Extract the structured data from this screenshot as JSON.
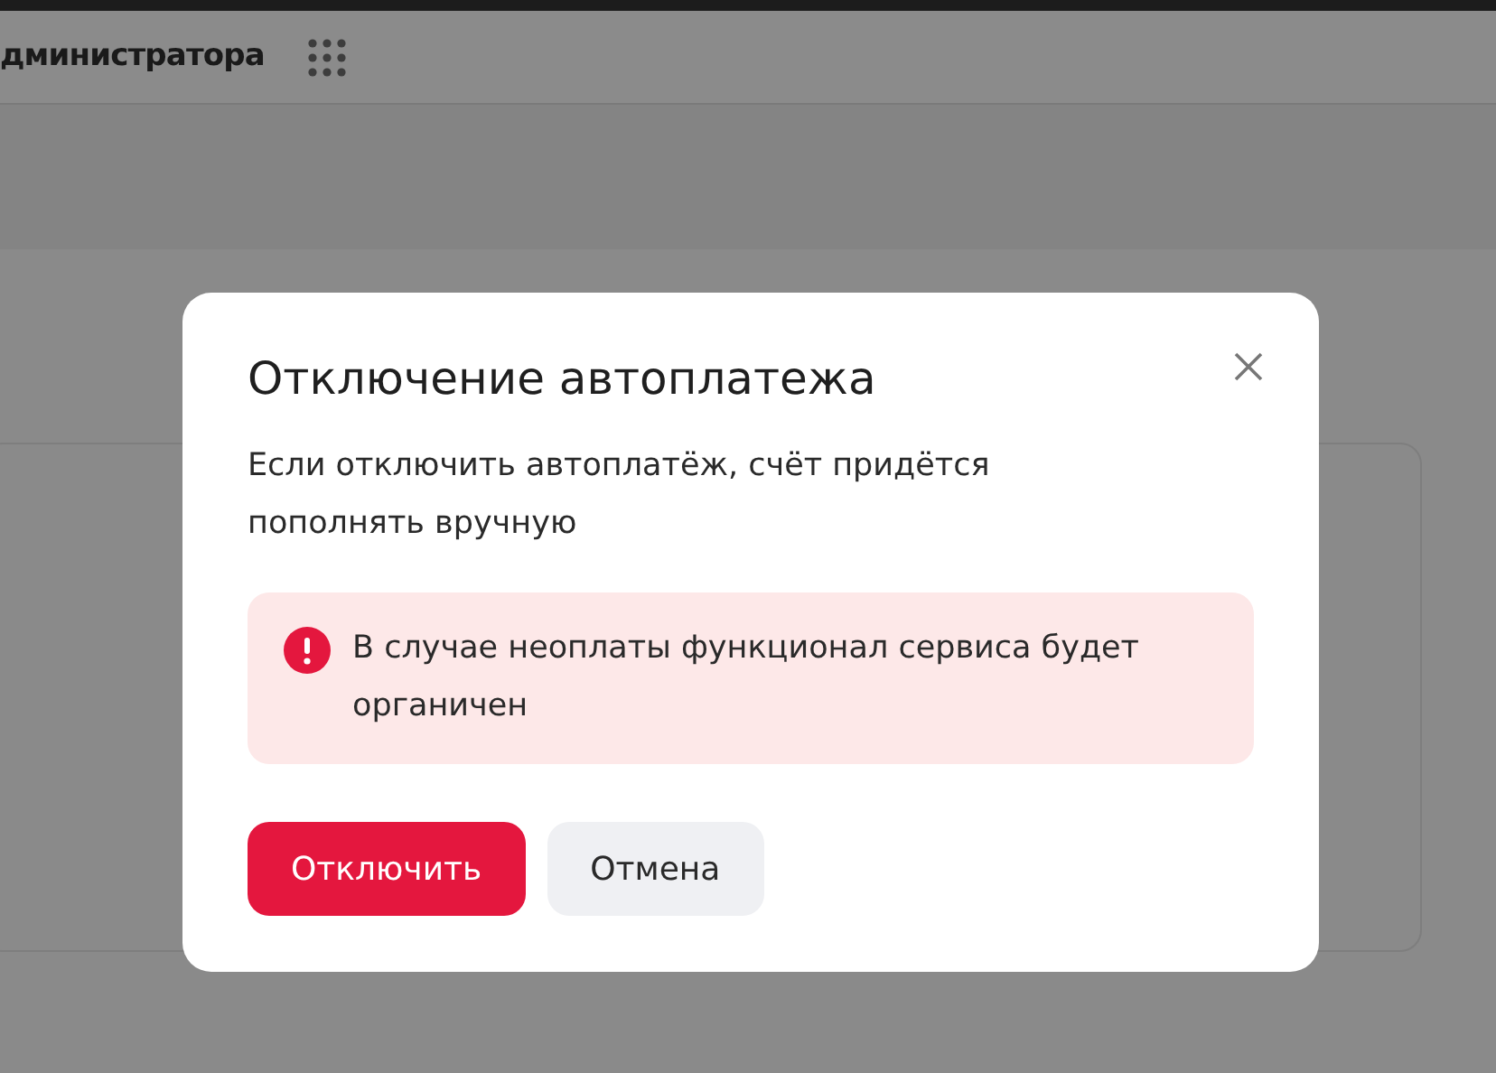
{
  "header": {
    "title": "дминистратора"
  },
  "dialog": {
    "title": "Отключение автоплатежа",
    "message": "Если отключить автоплатёж, счёт придётся пополнять вручную",
    "alert": {
      "text": "В случае неоплаты функционал сервиса будет органичен"
    },
    "buttons": [
      {
        "label": "Отключить",
        "kind": "primary"
      },
      {
        "label": "Отмена",
        "kind": "secondary"
      }
    ]
  }
}
